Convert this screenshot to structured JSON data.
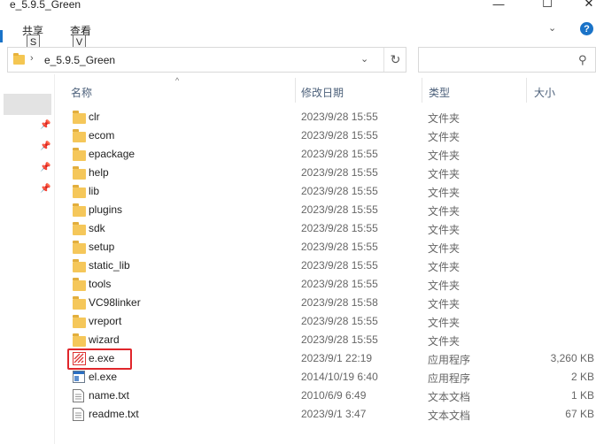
{
  "window": {
    "title": "e_5.9.5_Green",
    "min_glyph": "—",
    "max_glyph": "☐",
    "close_glyph": "✕"
  },
  "ribbon": {
    "tabs": [
      {
        "label": "共享",
        "keytip": "S"
      },
      {
        "label": "查看",
        "keytip": "V"
      }
    ],
    "expand_glyph": "⌄",
    "help_glyph": "?"
  },
  "address": {
    "path": "e_5.9.5_Green",
    "separator": "›",
    "dropdown_glyph": "⌄",
    "refresh_glyph": "↻"
  },
  "search": {
    "placeholder": "",
    "icon_glyph": "⚲"
  },
  "nav": {
    "pin_glyph": "📌"
  },
  "columns": {
    "name": "名称",
    "modified": "修改日期",
    "type": "类型",
    "size": "大小",
    "sort_glyph": "^"
  },
  "files": [
    {
      "name": "clr",
      "modified": "2023/9/28 15:55",
      "type": "文件夹",
      "size": "",
      "icon": "folder-icon"
    },
    {
      "name": "ecom",
      "modified": "2023/9/28 15:55",
      "type": "文件夹",
      "size": "",
      "icon": "folder-icon"
    },
    {
      "name": "epackage",
      "modified": "2023/9/28 15:55",
      "type": "文件夹",
      "size": "",
      "icon": "folder-icon"
    },
    {
      "name": "help",
      "modified": "2023/9/28 15:55",
      "type": "文件夹",
      "size": "",
      "icon": "folder-icon"
    },
    {
      "name": "lib",
      "modified": "2023/9/28 15:55",
      "type": "文件夹",
      "size": "",
      "icon": "folder-icon"
    },
    {
      "name": "plugins",
      "modified": "2023/9/28 15:55",
      "type": "文件夹",
      "size": "",
      "icon": "folder-icon"
    },
    {
      "name": "sdk",
      "modified": "2023/9/28 15:55",
      "type": "文件夹",
      "size": "",
      "icon": "folder-icon"
    },
    {
      "name": "setup",
      "modified": "2023/9/28 15:55",
      "type": "文件夹",
      "size": "",
      "icon": "folder-icon"
    },
    {
      "name": "static_lib",
      "modified": "2023/9/28 15:55",
      "type": "文件夹",
      "size": "",
      "icon": "folder-icon"
    },
    {
      "name": "tools",
      "modified": "2023/9/28 15:55",
      "type": "文件夹",
      "size": "",
      "icon": "folder-icon"
    },
    {
      "name": "VC98linker",
      "modified": "2023/9/28 15:58",
      "type": "文件夹",
      "size": "",
      "icon": "folder-icon"
    },
    {
      "name": "vreport",
      "modified": "2023/9/28 15:55",
      "type": "文件夹",
      "size": "",
      "icon": "folder-icon"
    },
    {
      "name": "wizard",
      "modified": "2023/9/28 15:55",
      "type": "文件夹",
      "size": "",
      "icon": "folder-icon"
    },
    {
      "name": "e.exe",
      "modified": "2023/9/1 22:19",
      "type": "应用程序",
      "size": "3,260 KB",
      "icon": "e-app-icon",
      "highlighted": true
    },
    {
      "name": "el.exe",
      "modified": "2014/10/19 6:40",
      "type": "应用程序",
      "size": "2 KB",
      "icon": "exe-window-icon"
    },
    {
      "name": "name.txt",
      "modified": "2010/6/9 6:49",
      "type": "文本文档",
      "size": "1 KB",
      "icon": "text-file-icon"
    },
    {
      "name": "readme.txt",
      "modified": "2023/9/1 3:47",
      "type": "文本文档",
      "size": "67 KB",
      "icon": "text-file-icon"
    }
  ],
  "colors": {
    "highlight_border": "#e0262b",
    "folder": "#f5c75a",
    "accent": "#1a73c8"
  }
}
